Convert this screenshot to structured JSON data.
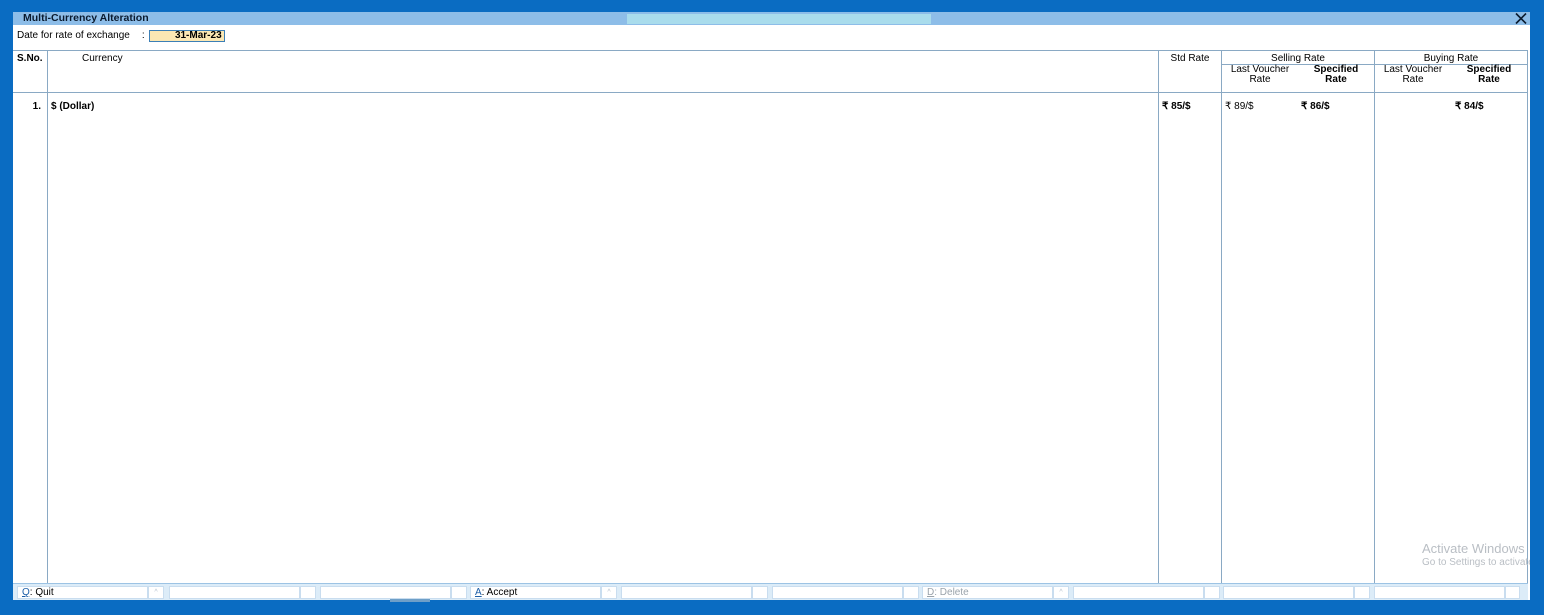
{
  "window": {
    "title": "Multi-Currency Alteration",
    "close_icon": "close-icon"
  },
  "date_row": {
    "label": "Date for rate of exchange",
    "colon": ":",
    "value": "31-Mar-23"
  },
  "table": {
    "headers": {
      "sno": "S.No.",
      "currency": "Currency",
      "std_rate": "Std Rate",
      "selling_rate": "Selling Rate",
      "buying_rate": "Buying Rate",
      "last_voucher_rate_line1": "Last Voucher",
      "last_voucher_rate_line2": "Rate",
      "specified_rate_line1": "Specified",
      "specified_rate_line2": "Rate"
    },
    "rows": [
      {
        "sno": "1.",
        "currency": "$ (Dollar)",
        "std_rate": "₹ 85/$",
        "selling_last_voucher": "₹ 89/$",
        "selling_specified": "₹ 86/$",
        "buying_last_voucher": "",
        "buying_specified": "₹ 84/$"
      }
    ]
  },
  "footer": {
    "quit": {
      "key": "Q",
      "label": ": Quit"
    },
    "accept": {
      "key": "A",
      "label": ": Accept"
    },
    "delete": {
      "key": "D",
      "label": ": Delete"
    },
    "sep_glyph": "^"
  },
  "watermark": {
    "line1": "Activate Windows",
    "line2": "Go to Settings to activate Windows."
  },
  "colors": {
    "background": "#0a6cc2",
    "titlebar": "#8dbde8",
    "date_field": "#fbe7b3"
  }
}
